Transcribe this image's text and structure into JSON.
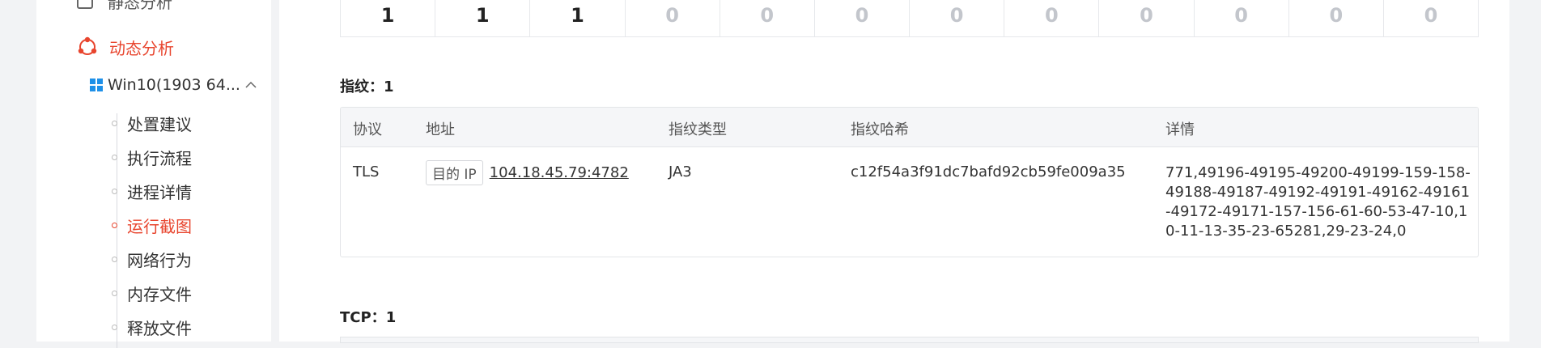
{
  "sidebar": {
    "static_analysis": "静态分析",
    "dynamic_analysis": "动态分析",
    "environment": "Win10(1903 64...",
    "items": [
      {
        "label": "处置建议"
      },
      {
        "label": "执行流程"
      },
      {
        "label": "进程详情"
      },
      {
        "label": "运行截图",
        "active": true
      },
      {
        "label": "网络行为"
      },
      {
        "label": "内存文件"
      },
      {
        "label": "释放文件"
      }
    ],
    "accent_color": "#e8452e"
  },
  "stats": {
    "values": [
      "1",
      "1",
      "1",
      "0",
      "0",
      "0",
      "0",
      "0",
      "0",
      "0",
      "0",
      "0"
    ]
  },
  "fingerprint": {
    "title": "指纹：",
    "count": "1",
    "columns": [
      "协议",
      "地址",
      "指纹类型",
      "指纹哈希",
      "详情"
    ],
    "rows": [
      {
        "protocol": "TLS",
        "addr_tag": "目的 IP",
        "address": "104.18.45.79:4782",
        "type": "JA3",
        "hash": "c12f54a3f91dc7bafd92cb59fe009a35",
        "detail": "771,49196-49195-49200-49199-159-158-49188-49187-49192-49191-49162-49161-49172-49171-157-156-61-60-53-47-10,10-11-13-35-23-65281,29-23-24,0"
      }
    ]
  },
  "tcp": {
    "title": "TCP：",
    "count": "1"
  }
}
